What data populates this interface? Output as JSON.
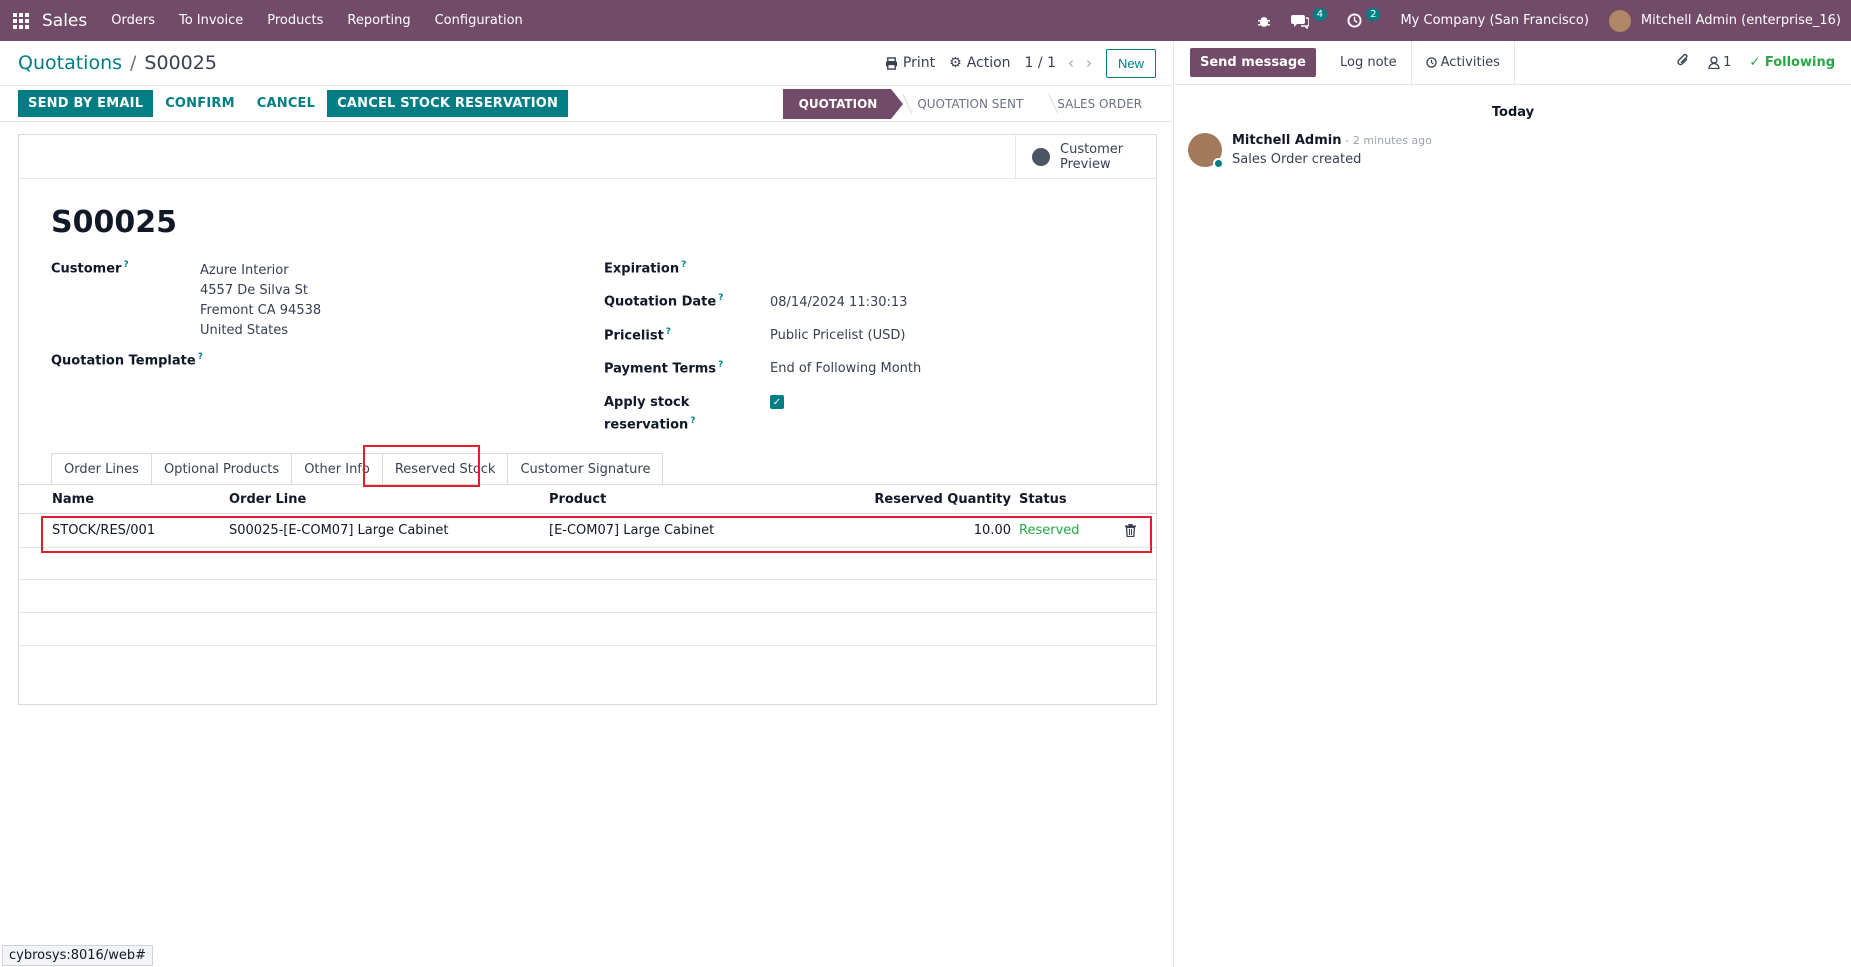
{
  "navbar": {
    "app_name": "Sales",
    "menu": [
      "Orders",
      "To Invoice",
      "Products",
      "Reporting",
      "Configuration"
    ],
    "messages_count": "4",
    "activities_count": "2",
    "company": "My Company (San Francisco)",
    "user": "Mitchell Admin (enterprise_16)"
  },
  "breadcrumb": {
    "parent": "Quotations",
    "sep": "/",
    "current": "S00025"
  },
  "control": {
    "print": "Print",
    "action": "Action",
    "pager": "1 / 1",
    "new": "New"
  },
  "actions": {
    "send_email": "SEND BY EMAIL",
    "confirm": "CONFIRM",
    "cancel": "CANCEL",
    "cancel_reservation": "CANCEL STOCK RESERVATION"
  },
  "stages": [
    "QUOTATION",
    "QUOTATION SENT",
    "SALES ORDER"
  ],
  "smart_button": {
    "line1": "Customer",
    "line2": "Preview"
  },
  "form": {
    "title": "S00025",
    "customer_label": "Customer",
    "customer_lines": [
      "Azure Interior",
      "4557 De Silva St",
      "Fremont CA 94538",
      "United States"
    ],
    "template_label": "Quotation Template",
    "expiration_label": "Expiration",
    "quotation_date_label": "Quotation Date",
    "quotation_date": "08/14/2024 11:30:13",
    "pricelist_label": "Pricelist",
    "pricelist": "Public Pricelist (USD)",
    "payment_terms_label": "Payment Terms",
    "payment_terms": "End of Following Month",
    "apply_stock_label_1": "Apply stock",
    "apply_stock_label_2": "reservation",
    "help": "?"
  },
  "tabs": [
    "Order Lines",
    "Optional Products",
    "Other Info",
    "Reserved Stock",
    "Customer Signature"
  ],
  "table": {
    "headers": {
      "name": "Name",
      "order_line": "Order Line",
      "product": "Product",
      "qty": "Reserved Quantity",
      "status": "Status"
    },
    "rows": [
      {
        "name": "STOCK/RES/001",
        "order_line": "S00025-[E-COM07] Large Cabinet",
        "product": "[E-COM07] Large Cabinet",
        "qty": "10.00",
        "status": "Reserved"
      }
    ]
  },
  "chatter": {
    "send_message": "Send message",
    "log_note": "Log note",
    "activities": "Activities",
    "followers": "1",
    "following": "Following",
    "today": "Today",
    "author": "Mitchell Admin",
    "time": "- 2 minutes ago",
    "body": "Sales Order created"
  },
  "status_url": "cybrosys:8016/web#"
}
